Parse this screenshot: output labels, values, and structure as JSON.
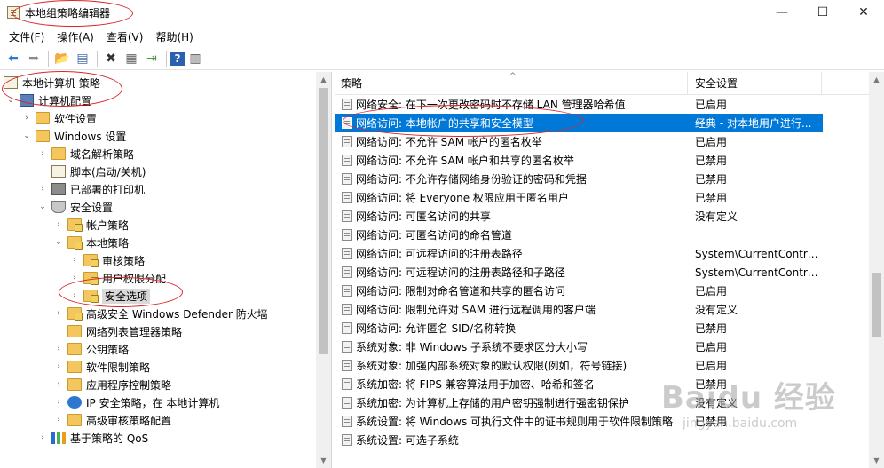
{
  "window": {
    "title": "本地组策略编辑器",
    "controls": {
      "minimize": "—",
      "maximize": "☐",
      "close": "✕"
    }
  },
  "menu": [
    "文件(F)",
    "操作(A)",
    "查看(V)",
    "帮助(H)"
  ],
  "toolbar": {
    "icons": [
      "back-arrow-icon",
      "forward-arrow-icon",
      "up-folder-icon",
      "show-hide-tree-icon",
      "delete-icon",
      "properties-icon",
      "export-list-icon",
      "help-icon",
      "show-action-pane-icon"
    ],
    "glyphs": {
      "back": "⬅",
      "forward": "➡",
      "up": "📂",
      "tree": "▤",
      "delete": "✖",
      "properties": "▦",
      "export": "⇥",
      "help": "?",
      "action": "▥"
    }
  },
  "tree": [
    {
      "label": "本地计算机 策略",
      "icon": "doc",
      "expander": "",
      "level": 0
    },
    {
      "label": "计算机配置",
      "icon": "computer",
      "expander": "⌄",
      "level": 1
    },
    {
      "label": "软件设置",
      "icon": "folder",
      "expander": "›",
      "level": 2
    },
    {
      "label": "Windows 设置",
      "icon": "folder",
      "expander": "⌄",
      "level": 2
    },
    {
      "label": "域名解析策略",
      "icon": "folder",
      "expander": "›",
      "level": 3
    },
    {
      "label": "脚本(启动/关机)",
      "icon": "script",
      "expander": "",
      "level": 3
    },
    {
      "label": "已部署的打印机",
      "icon": "printer",
      "expander": "›",
      "level": 3
    },
    {
      "label": "安全设置",
      "icon": "shield",
      "expander": "⌄",
      "level": 3
    },
    {
      "label": "帐户策略",
      "icon": "folder-lock",
      "expander": "›",
      "level": 4
    },
    {
      "label": "本地策略",
      "icon": "folder-lock",
      "expander": "⌄",
      "level": 4
    },
    {
      "label": "审核策略",
      "icon": "folder-lock",
      "expander": "›",
      "level": 5
    },
    {
      "label": "用户权限分配",
      "icon": "folder-lock",
      "expander": "›",
      "level": 5
    },
    {
      "label": "安全选项",
      "icon": "folder-lock",
      "expander": "›",
      "level": 5,
      "selected": true
    },
    {
      "label": "高级安全 Windows Defender 防火墙",
      "icon": "folder-lock",
      "expander": "›",
      "level": 4
    },
    {
      "label": "网络列表管理器策略",
      "icon": "folder",
      "expander": "",
      "level": 4
    },
    {
      "label": "公钥策略",
      "icon": "folder",
      "expander": "›",
      "level": 4
    },
    {
      "label": "软件限制策略",
      "icon": "folder",
      "expander": "›",
      "level": 4
    },
    {
      "label": "应用程序控制策略",
      "icon": "folder",
      "expander": "›",
      "level": 4
    },
    {
      "label": "IP 安全策略，在 本地计算机",
      "icon": "globe",
      "expander": "›",
      "level": 4
    },
    {
      "label": "高级审核策略配置",
      "icon": "folder",
      "expander": "›",
      "level": 4
    },
    {
      "label": "基于策略的 QoS",
      "icon": "bars",
      "expander": "›",
      "level": 3
    }
  ],
  "list": {
    "columns": {
      "policy": "策略",
      "setting": "安全设置"
    },
    "sort_glyph": "^",
    "rows": [
      {
        "policy": "网络安全: 在下一次更改密码时不存储 LAN 管理器哈希值",
        "setting": "已启用"
      },
      {
        "policy": "网络访问: 本地帐户的共享和安全模型",
        "setting": "经典 - 对本地用户进行...",
        "selected": true
      },
      {
        "policy": "网络访问: 不允许 SAM 帐户的匿名枚举",
        "setting": "已启用"
      },
      {
        "policy": "网络访问: 不允许 SAM 帐户和共享的匿名枚举",
        "setting": "已禁用"
      },
      {
        "policy": "网络访问: 不允许存储网络身份验证的密码和凭据",
        "setting": "已禁用"
      },
      {
        "policy": "网络访问: 将 Everyone 权限应用于匿名用户",
        "setting": "已禁用"
      },
      {
        "policy": "网络访问: 可匿名访问的共享",
        "setting": "没有定义"
      },
      {
        "policy": "网络访问: 可匿名访问的命名管道",
        "setting": ""
      },
      {
        "policy": "网络访问: 可远程访问的注册表路径",
        "setting": "System\\CurrentContro..."
      },
      {
        "policy": "网络访问: 可远程访问的注册表路径和子路径",
        "setting": "System\\CurrentContro..."
      },
      {
        "policy": "网络访问: 限制对命名管道和共享的匿名访问",
        "setting": "已启用"
      },
      {
        "policy": "网络访问: 限制允许对 SAM 进行远程调用的客户端",
        "setting": "没有定义"
      },
      {
        "policy": "网络访问: 允许匿名 SID/名称转换",
        "setting": "已禁用"
      },
      {
        "policy": "系统对象: 非 Windows 子系统不要求区分大小写",
        "setting": "已启用"
      },
      {
        "policy": "系统对象: 加强内部系统对象的默认权限(例如，符号链接)",
        "setting": "已启用"
      },
      {
        "policy": "系统加密: 将 FIPS 兼容算法用于加密、哈希和签名",
        "setting": "已禁用"
      },
      {
        "policy": "系统加密: 为计算机上存储的用户密钥强制进行强密钥保护",
        "setting": "没有定义"
      },
      {
        "policy": "系统设置: 将 Windows 可执行文件中的证书规则用于软件限制策略",
        "setting": "已禁用"
      },
      {
        "policy": "系统设置: 可选子系统",
        "setting": ""
      }
    ]
  },
  "scrollbars": {
    "up": "▲",
    "down": "▼"
  },
  "watermark": {
    "main": "Baidu 经验",
    "sub": "jingyan.baidu.com"
  },
  "colors": {
    "selection": "#0078d7",
    "annotation": "#d7262b",
    "folder": "#f3c75e"
  }
}
